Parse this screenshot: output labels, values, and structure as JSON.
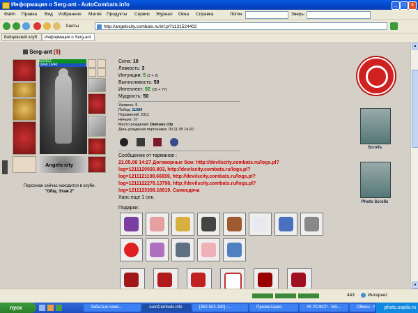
{
  "window": {
    "title": "Информация о Serg-ant - AutoCombats.info"
  },
  "menu": [
    "Файл",
    "Правка",
    "Вид",
    "Избранное",
    "Магия",
    "Продукты",
    "Сервис",
    "Журнал",
    "Окна",
    "Справка"
  ],
  "menu_fields": {
    "login_label": "Логин",
    "search_label": "Зверь:"
  },
  "toolbar": {
    "address": "http://angelscity.combats.ru/inf.pl?1131524402",
    "bookmarks_label": "Хаоты"
  },
  "tabs": [
    "Бойцовский клуб",
    "Информация о Serg-ant"
  ],
  "char": {
    "nick": "Serg-ant",
    "level": "[9]",
    "hp": "822/822",
    "mp": "16/40 16/40",
    "city": "Angels city",
    "location": "Персонаж сейчас находится в клубе.",
    "place": "\"Общ. Этаж 2\""
  },
  "stats": {
    "str_label": "Сила:",
    "str": "10",
    "agi_label": "Ловкость:",
    "agi": "3",
    "int_label": "Интуиция:",
    "int": "5",
    "int_bonus": "(3 + 2)",
    "end_label": "Выносливость:",
    "end": "50",
    "intel_label": "Интеллект:",
    "intel": "92",
    "intel_bonus": "(15 + 77)",
    "wis_label": "Мудрость:",
    "wis": "50"
  },
  "info": {
    "level": "Уровень: 9",
    "wins_label": "Побед:",
    "wins": "11089",
    "losses": "Поражений: 2311",
    "draws": "Ничьих: 37",
    "birth_label": "Место рождения:",
    "birth": "Demons city",
    "birthday": "День рождения персонажа: 09.11.05 14:20"
  },
  "messages": {
    "header": "Сообщение от тарманов :",
    "lines": [
      "21.05.08 14:27 Договорные бои: http://devilscity.combats.ru/logs.pl?",
      "log=1211120030.803, http://devilscity.combats.ru/logs.pl?",
      "log=1211121108.66659, http://devilscity.combats.ru/logs.pl?",
      "log=1211122278.13798, http://devilscity.combats.ru/logs.pl?",
      "log=1211123309.18919. Самосдача"
    ],
    "chaos": "Хаос еще 1 сек.",
    "gifts_label": "Подарки:"
  },
  "side": {
    "scrolls": "Scrolls",
    "photo": "Photo Scrolls"
  },
  "taskbar": {
    "start": "пуск",
    "tasks": [
      "Забытые изме...",
      "AutoCombats.info",
      "[352-502-180] -...",
      "Презентация",
      "УК РСФСР - Mic...",
      "Обмен - Mic..."
    ],
    "time": "photo.sopils.ru"
  },
  "status": {
    "zone": "Интернет",
    "num": "443"
  }
}
